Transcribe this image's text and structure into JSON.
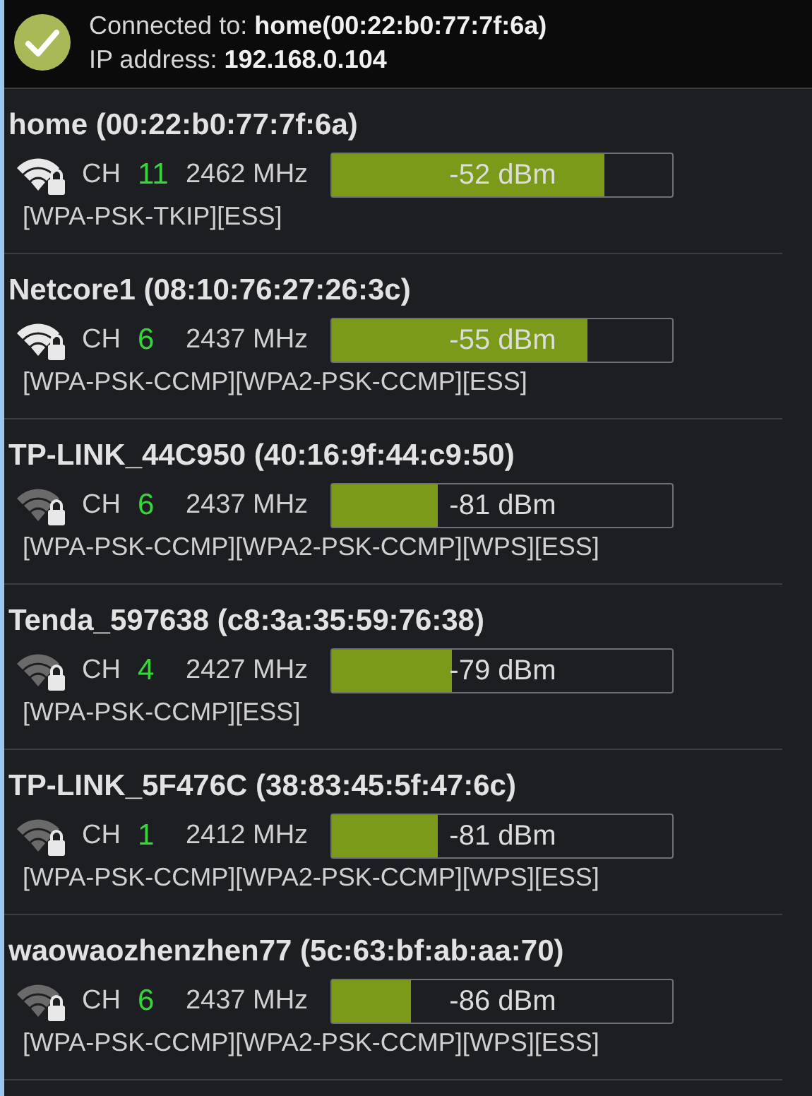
{
  "status": {
    "connected": "Connected to: **home(00:22:b0:77:7f:6a)**",
    "ip": "IP address: **192.168.0.104**"
  },
  "networks": [
    {
      "name": "home (00:22:b0:77:7f:6a)",
      "ch_label": "CH",
      "channel": "11",
      "freq": "2462 MHz",
      "level": 0.8,
      "reading": "-52 dBm",
      "security": "[WPA-PSK-TKIP][ESS]"
    },
    {
      "name": "Netcore1 (08:10:76:27:26:3c)",
      "ch_label": "CH",
      "channel": "6",
      "freq": "2437 MHz",
      "level": 0.75,
      "reading": "-55 dBm",
      "security": "[WPA-PSK-CCMP][WPA2-PSK-CCMP][ESS]"
    },
    {
      "name": "TP-LINK_44C950 (40:16:9f:44:c9:50)",
      "ch_label": "CH",
      "channel": "6",
      "freq": "2437 MHz",
      "level": 0.31,
      "reading": "-81 dBm",
      "security": "[WPA-PSK-CCMP][WPA2-PSK-CCMP][WPS][ESS]"
    },
    {
      "name": "Tenda_597638 (c8:3a:35:59:76:38)",
      "ch_label": "CH",
      "channel": "4",
      "freq": "2427 MHz",
      "level": 0.35,
      "reading": "-79 dBm",
      "security": "[WPA-PSK-CCMP][ESS]"
    },
    {
      "name": "TP-LINK_5F476C (38:83:45:5f:47:6c)",
      "ch_label": "CH",
      "channel": "1",
      "freq": "2412 MHz",
      "level": 0.31,
      "reading": "-81 dBm",
      "security": "[WPA-PSK-CCMP][WPA2-PSK-CCMP][WPS][ESS]"
    },
    {
      "name": "waowaozhenzhen77 (5c:63:bf:ab:aa:70)",
      "ch_label": "CH",
      "channel": "6",
      "freq": "2437 MHz",
      "level": 0.23,
      "reading": "-86 dBm",
      "security": "[WPA-PSK-CCMP][WPA2-PSK-CCMP][WPS][ESS]"
    }
  ]
}
